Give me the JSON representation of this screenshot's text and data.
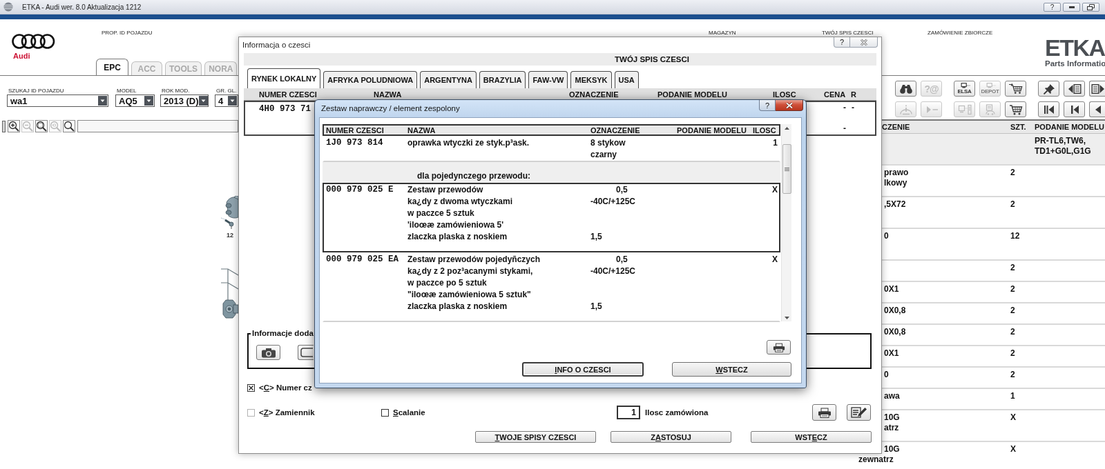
{
  "window": {
    "title": "ETKA - Audi wer. 8.0 Aktualizacja 1212",
    "help_label": "?"
  },
  "header": {
    "brand": "Audi",
    "labels": [
      "PROP. ID POJAZDU",
      "MAGAZYN",
      "TWÓJ SPIS CZESCI",
      "ZAMÓWIENIE ZBIORCZE"
    ],
    "logo": "ETKA",
    "logo_subtitle": "Parts Informatio"
  },
  "main_tabs": [
    {
      "label": "EPC",
      "selected": true
    },
    {
      "label": "ACC",
      "selected": false
    },
    {
      "label": "TOOLS",
      "selected": false
    },
    {
      "label": "NORA",
      "selected": false
    }
  ],
  "vehicle_fields": [
    {
      "label": "SZUKAJ ID POJAZDU",
      "value": "wa1"
    },
    {
      "label": "MODEL",
      "value": "AQ5"
    },
    {
      "label": "ROK MOD.",
      "value": "2013 (D)"
    },
    {
      "label": "GR. GL.",
      "value": "4"
    }
  ],
  "zoom_toolbar": [
    {
      "kind": "zoom-in",
      "disabled": false
    },
    {
      "kind": "zoom-out",
      "disabled": true
    },
    {
      "kind": "zoom-area",
      "disabled": false
    },
    {
      "kind": "zoom-100",
      "disabled": true
    },
    {
      "kind": "search",
      "disabled": false
    }
  ],
  "diagram": {
    "callouts": [
      "12"
    ]
  },
  "toolbar_rows": [
    {
      "groups": [
        {
          "buttons": [
            {
              "kind": "binoculars",
              "disabled": false
            },
            {
              "kind": "help-at",
              "glyph": "?@",
              "disabled": true
            }
          ]
        },
        {
          "buttons": [
            {
              "kind": "computer",
              "label": "ELSA",
              "disabled": false
            },
            {
              "kind": "computer",
              "label": "DEPOT",
              "disabled": true
            },
            {
              "kind": "cart-arrow",
              "disabled": false
            }
          ]
        },
        {
          "buttons": [
            {
              "kind": "pin",
              "disabled": false
            },
            {
              "kind": "doc-left",
              "disabled": false
            },
            {
              "kind": "doc-right",
              "disabled": false
            }
          ]
        }
      ]
    },
    {
      "groups": [
        {
          "buttons": [
            {
              "kind": "car-info",
              "disabled": true
            },
            {
              "kind": "play-dash",
              "disabled": true
            }
          ]
        },
        {
          "buttons": [
            {
              "kind": "computer-panel",
              "disabled": true
            },
            {
              "kind": "car-doc",
              "disabled": true
            },
            {
              "kind": "cart",
              "disabled": false
            }
          ]
        },
        {
          "buttons": [
            {
              "kind": "first",
              "disabled": false
            },
            {
              "kind": "prev",
              "disabled": false
            },
            {
              "kind": "back",
              "disabled": false
            }
          ]
        }
      ]
    }
  ],
  "parts_table": {
    "columns": [
      "CZENIE",
      "SZT.",
      "PODANIE MODELU"
    ],
    "rows": [
      {
        "shaded": true,
        "podanie_modelu": [
          "PR-TL6,TW6,",
          "TD1+G0L,G1G"
        ]
      },
      {
        "shaded": false,
        "column_1": [
          "prawo",
          "lkowy"
        ],
        "szt": "2"
      },
      {
        "shaded": false,
        "column_1": [
          ",5X72"
        ],
        "szt": "2"
      },
      {
        "shaded": false,
        "column_1": [
          "0"
        ],
        "szt": "12"
      },
      {
        "shaded": false,
        "szt": "2"
      },
      {
        "shaded": false,
        "column_1": [
          "0X1"
        ],
        "szt": "2"
      },
      {
        "shaded": false,
        "column_1": [
          "0X0,8"
        ],
        "szt": "2"
      },
      {
        "shaded": false,
        "column_1": [
          "0X0,8"
        ],
        "szt": "2"
      },
      {
        "shaded": false,
        "column_1": [
          "0X1"
        ],
        "szt": "2"
      },
      {
        "shaded": false,
        "column_1": [
          "0"
        ],
        "szt": "2"
      },
      {
        "shaded": false,
        "column_1": [
          "awa"
        ],
        "szt": "1"
      },
      {
        "shaded": false,
        "column_1": [
          "10G",
          "atrz"
        ],
        "szt": "X"
      },
      {
        "shaded": false,
        "column_1": [
          "10G",
          "zewnatrz"
        ],
        "szt": "X"
      }
    ]
  },
  "info_dialog": {
    "title": "Informacja o czesci",
    "help_label": "?",
    "heading": "TWÓJ SPIS CZESCI",
    "tabs": [
      {
        "label": "RYNEK LOKALNY",
        "selected": true
      },
      {
        "label": "AFRYKA POLUDNIOWA",
        "selected": false
      },
      {
        "label": "ARGENTYNA",
        "selected": false
      },
      {
        "label": "BRAZYLIA",
        "selected": false
      },
      {
        "label": "FAW-VW",
        "selected": false
      },
      {
        "label": "MEKSYK",
        "selected": false
      },
      {
        "label": "USA",
        "selected": false
      }
    ],
    "table": {
      "columns": [
        "NUMER CZESCI",
        "NAZWA",
        "OZNACZENIE",
        "PODANIE MODELU",
        "ILOSC",
        "CENA",
        "R"
      ],
      "rows": [
        {
          "numer_czesci": "4H0 973 71",
          "cena": [
            "-",
            "-"
          ],
          "r": "-",
          "selected": true
        }
      ]
    },
    "extra_info": {
      "label": "Informacje doda",
      "buttons": [
        {
          "kind": "camera"
        },
        {
          "kind": "frame"
        }
      ]
    },
    "option_rows": [
      [
        {
          "label": [
            {
              "text": "<",
              "underlined": false
            },
            {
              "text": "C",
              "underlined": true
            },
            {
              "text": "> Numer cz",
              "underlined": false
            }
          ],
          "checked": true,
          "disabled": false
        }
      ],
      [
        {
          "label": [
            {
              "text": "<",
              "underlined": false
            },
            {
              "text": "Z",
              "underlined": true
            },
            {
              "text": "> Zamiennik",
              "underlined": false
            }
          ],
          "checked": false,
          "disabled": true
        },
        {
          "label": [
            {
              "text": "S",
              "underlined": true
            },
            {
              "text": "calanie",
              "underlined": false
            }
          ],
          "checked": false,
          "disabled": false
        }
      ]
    ],
    "quantity": {
      "value": "1",
      "label": "Ilosc zamówiona"
    },
    "tools": [
      {
        "kind": "print"
      },
      {
        "kind": "edit"
      }
    ],
    "buttons": [
      {
        "label": [
          {
            "text": "T",
            "underlined": true
          },
          {
            "text": "WOJE SPISY CZESCI",
            "underlined": false
          }
        ]
      },
      {
        "label": [
          {
            "text": "Z",
            "underlined": false
          },
          {
            "text": "A",
            "underlined": true
          },
          {
            "text": "STOSUJ",
            "underlined": false
          }
        ]
      },
      {
        "label": [
          {
            "text": "WST",
            "underlined": false
          },
          {
            "text": "E",
            "underlined": true
          },
          {
            "text": "CZ",
            "underlined": false
          }
        ]
      }
    ]
  },
  "kit_dialog": {
    "title": "Zestaw naprawczy / element zespolony",
    "help_label": "?",
    "columns": [
      "NUMER CZESCI",
      "NAZWA",
      "OZNACZENIE",
      "PODANIE MODELU",
      "ILOSC"
    ],
    "rows": [
      {
        "kind": "part",
        "selected": false,
        "part_number": "1J0 973 814",
        "quantity": "1",
        "lines": [
          {
            "name": "oprawka wtyczki ze styk.p³ask.",
            "designation": "8 stykow"
          },
          {
            "designation": "czarny"
          }
        ]
      },
      {
        "kind": "section",
        "selected": false,
        "title": "dla pojedynczego przewodu:"
      },
      {
        "kind": "part",
        "selected": true,
        "part_number": "000 979 025 E",
        "quantity": "X",
        "lines": [
          {
            "name": "Zestaw przewodów",
            "cross_section": "0,5"
          },
          {
            "name": "ka¿dy z dwoma wtyczkami",
            "designation": "-40C/+125C"
          },
          {
            "name": "w paczce 5 sztuk"
          },
          {
            "name": "'iloœæ zamówieniowa 5'"
          },
          {
            "name": "zlaczka plaska z noskiem",
            "designation": "1,5"
          }
        ]
      },
      {
        "kind": "part",
        "selected": false,
        "part_number": "000 979 025 EA",
        "quantity": "X",
        "lines": [
          {
            "name": "Zestaw przewodów pojedyñczych",
            "cross_section": "0,5"
          },
          {
            "name": "ka¿dy z 2 poz³acanymi stykami,",
            "designation": "-40C/+125C"
          },
          {
            "name": "w paczce po 5 sztuk"
          },
          {
            "name": "\"iloœæ zamówieniowa 5 sztuk\""
          },
          {
            "name": "zlaczka plaska z noskiem",
            "designation": "1,5"
          }
        ]
      }
    ],
    "tools": [
      {
        "kind": "print"
      }
    ],
    "buttons": [
      {
        "label": [
          {
            "text": "I",
            "underlined": true
          },
          {
            "text": "NFO O CZESCI",
            "underlined": false
          }
        ],
        "default": true
      },
      {
        "label": [
          {
            "text": "W",
            "underlined": true
          },
          {
            "text": "STECZ",
            "underlined": false
          }
        ],
        "default": false
      }
    ]
  }
}
